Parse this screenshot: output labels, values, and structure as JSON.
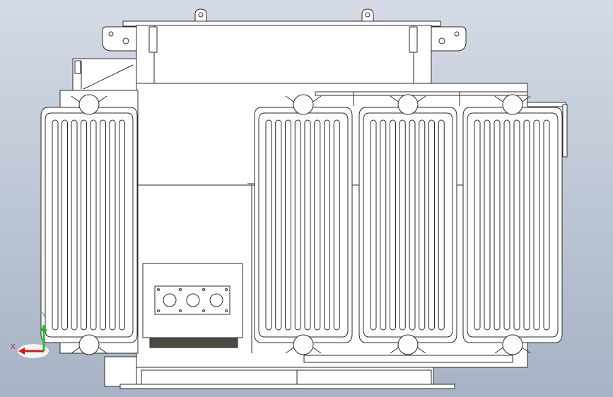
{
  "viewport": {
    "background_top": "#d4dbe6",
    "background_bottom": "#a7b2c4",
    "line_color": "#2a2a2a",
    "fill_color": "#ffffff",
    "tank_base_shadow": "#4a4a40"
  },
  "model": {
    "radiator_groups": 4,
    "fins_per_radiator": 8,
    "bushings_count": 3
  },
  "triad": {
    "x_label": "X",
    "y_label": "Y",
    "x_color": "#d21a1a",
    "y_color": "#1fbf2a",
    "z_color": "#2a45d8"
  }
}
